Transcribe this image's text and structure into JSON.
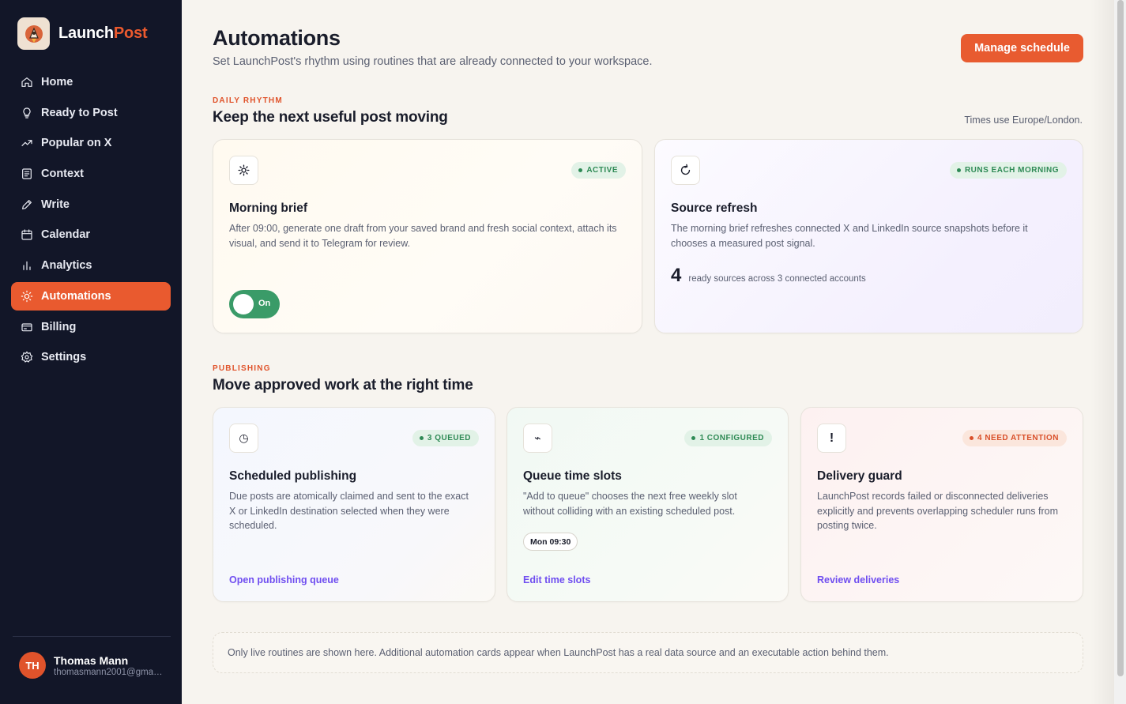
{
  "app": {
    "name_part1": "Launch",
    "name_part2": "Post",
    "accent": "#e95a2f",
    "sidebar_bg": "#121628"
  },
  "sidebar": {
    "items": [
      {
        "label": "Home",
        "icon": "home-icon"
      },
      {
        "label": "Ready to Post",
        "icon": "lightbulb-icon"
      },
      {
        "label": "Popular on X",
        "icon": "trending-up-icon"
      },
      {
        "label": "Context",
        "icon": "document-icon"
      },
      {
        "label": "Write",
        "icon": "pencil-icon"
      },
      {
        "label": "Calendar",
        "icon": "calendar-icon"
      },
      {
        "label": "Analytics",
        "icon": "bar-chart-icon"
      },
      {
        "label": "Automations",
        "icon": "sun-icon",
        "active": true
      },
      {
        "label": "Billing",
        "icon": "card-icon"
      },
      {
        "label": "Settings",
        "icon": "gear-icon"
      }
    ],
    "user": {
      "initials": "TH",
      "name": "Thomas Mann",
      "email": "thomasmann2001@gmai..."
    }
  },
  "header": {
    "title": "Automations",
    "subtitle": "Set LaunchPost's rhythm using routines that are already connected to your workspace.",
    "manage_button": "Manage schedule"
  },
  "daily": {
    "kicker": "DAILY RHYTHM",
    "title": "Keep the next useful post moving",
    "timezone_note": "Times use Europe/London.",
    "cards": [
      {
        "icon": "sun-icon",
        "badge": "ACTIVE",
        "title": "Morning brief",
        "description_line1": "After 09:00, generate one draft from your saved brand and fresh social context, attach its",
        "description_line2": "visual, and send it to Telegram for review.",
        "toggle_label": "On",
        "toggle_on": true
      },
      {
        "icon": "refresh-icon",
        "badge": "RUNS EACH MORNING",
        "title": "Source refresh",
        "description_line1": "The morning brief refreshes connected X and LinkedIn source snapshots before it",
        "description_line2": "chooses a measured post signal.",
        "stat_value": "4",
        "stat_label": "ready sources across 3 connected accounts"
      }
    ]
  },
  "publishing": {
    "kicker": "PUBLISHING",
    "title": "Move approved work at the right time",
    "cards": [
      {
        "icon": "clock-icon",
        "icon_glyph": "◷",
        "badge": "3 QUEUED",
        "title": "Scheduled publishing",
        "description_line1": "Due posts are atomically claimed and sent to the exact",
        "description_line2": "X or LinkedIn destination selected when they were",
        "description_line3": "scheduled.",
        "link": "Open publishing queue"
      },
      {
        "icon": "lightning-icon",
        "icon_glyph": "⌁",
        "badge": "1 CONFIGURED",
        "title": "Queue time slots",
        "description_line1": "\"Add to queue\" chooses the next free weekly slot",
        "description_line2": "without colliding with an existing scheduled post.",
        "slot": "Mon 09:30",
        "link": "Edit time slots"
      },
      {
        "icon": "exclamation-icon",
        "icon_glyph": "!",
        "badge": "4 NEED ATTENTION",
        "title": "Delivery guard",
        "description_line1": "LaunchPost records failed or disconnected deliveries",
        "description_line2": "explicitly and prevents overlapping scheduler runs from",
        "description_line3": "posting twice.",
        "link": "Review deliveries"
      }
    ]
  },
  "footnote": "Only live routines are shown here. Additional automation cards appear when LaunchPost has a real data source and an executable action behind them."
}
